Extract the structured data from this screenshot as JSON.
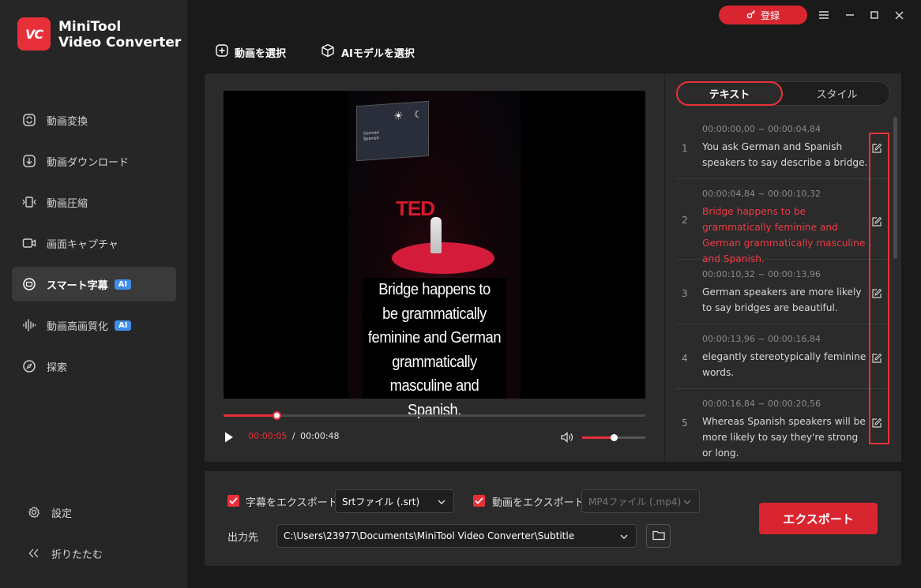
{
  "app": {
    "logo_text": "VC",
    "name_line1": "MiniTool",
    "name_line2": "Video Converter"
  },
  "sidebar": {
    "items": [
      {
        "label": "動画変換",
        "icon": "convert-icon",
        "badge": ""
      },
      {
        "label": "動画ダウンロード",
        "icon": "download-icon",
        "badge": ""
      },
      {
        "label": "動画圧縮",
        "icon": "compress-icon",
        "badge": ""
      },
      {
        "label": "画面キャプチャ",
        "icon": "camera-icon",
        "badge": ""
      },
      {
        "label": "スマート字幕",
        "icon": "subtitle-icon",
        "badge": "AI",
        "active": true
      },
      {
        "label": "動画高画質化",
        "icon": "waveform-icon",
        "badge": "AI"
      },
      {
        "label": "探索",
        "icon": "compass-icon",
        "badge": ""
      }
    ],
    "settings_label": "設定",
    "collapse_label": "折りたたむ"
  },
  "header": {
    "register_label": "登録",
    "select_video_label": "動画を選択",
    "select_ai_model_label": "AIモデルを選択"
  },
  "player": {
    "overlay_subtitle_lines": [
      "Bridge happens to",
      "be grammatically",
      "feminine and German",
      "grammatically",
      "masculine and Spanish."
    ],
    "stage_logo": "TED",
    "screen_text": [
      "German",
      "Spanish"
    ],
    "current_time": "00:00:05",
    "separator": "/",
    "total_time": "00:00:48",
    "progress_fraction": 0.125,
    "volume_fraction": 0.5
  },
  "subtitle_panel": {
    "tabs": [
      "テキスト",
      "スタイル"
    ],
    "active_tab": 0,
    "entries": [
      {
        "index": "1",
        "time": "00:00:00,00 ~ 00:00:04,84",
        "text": "You ask German and Spanish speakers to say describe a bridge."
      },
      {
        "index": "2",
        "time": "00:00:04,84 ~ 00:00:10,32",
        "text": "Bridge happens to be grammatically feminine and German grammatically masculine and Spanish.",
        "highlighted": true
      },
      {
        "index": "3",
        "time": "00:00:10,32 ~ 00:00:13,96",
        "text": "German speakers are more likely to say bridges are beautiful."
      },
      {
        "index": "4",
        "time": "00:00:13,96 ~ 00:00:16,84",
        "text": "elegantly stereotypically feminine words."
      },
      {
        "index": "5",
        "time": "00:00:16,84 ~ 00:00:20,56",
        "text": "Whereas Spanish speakers will be more likely to say they're strong or long."
      }
    ]
  },
  "export": {
    "subtitle_export_label": "字幕をエクスポート",
    "subtitle_format": "Srtファイル (.srt)",
    "video_export_label": "動画をエクスポート",
    "video_format": "MP4ファイル (.mp4)",
    "output_label": "出力先",
    "output_path": "C:\\Users\\23977\\Documents\\MiniTool Video Converter\\Subtitle",
    "export_button_label": "エクスポート"
  },
  "colors": {
    "accent": "#e8303a",
    "background": "#1a1a1a",
    "sidebar": "#262626",
    "panel": "#2b2b2b",
    "ai_badge": "#3f8ee8"
  }
}
